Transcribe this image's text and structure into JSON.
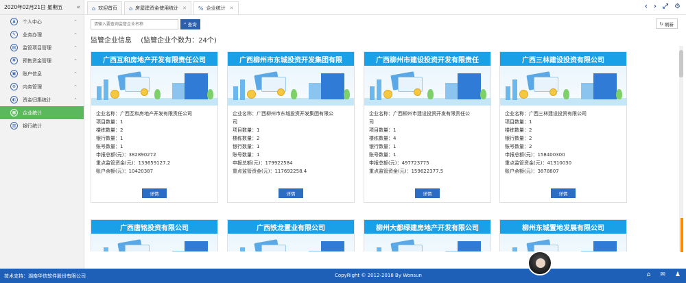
{
  "sidebar": {
    "date": "2020年02月21日 星期五",
    "collapse_icon": "«",
    "items": [
      {
        "label": "个人中心",
        "icon": "user-icon",
        "glyph": "♟"
      },
      {
        "label": "业务办理",
        "icon": "briefcase-icon",
        "glyph": "✎"
      },
      {
        "label": "监管项目管理",
        "icon": "project-icon",
        "glyph": "▤"
      },
      {
        "label": "预售资金管理",
        "icon": "fund-icon",
        "glyph": "¥"
      },
      {
        "label": "账户信息",
        "icon": "account-icon",
        "glyph": "▣"
      },
      {
        "label": "内务管理",
        "icon": "gear-icon",
        "glyph": "⚙"
      },
      {
        "label": "资金归集统计",
        "icon": "stats-icon",
        "glyph": "◐"
      },
      {
        "label": "企业统计",
        "icon": "enterprise-icon",
        "glyph": "▦",
        "active": true
      },
      {
        "label": "银行统计",
        "icon": "bank-icon",
        "glyph": "▥"
      }
    ]
  },
  "tabs": [
    {
      "label": "欢迎首页",
      "icon": "home-icon",
      "glyph": "⌂",
      "closable": false
    },
    {
      "label": "房屋建资金使用统计",
      "icon": "bank-icon",
      "glyph": "⌂",
      "closable": true
    },
    {
      "label": "企业统计",
      "icon": "percent-icon",
      "glyph": "%",
      "closable": true,
      "active": true
    }
  ],
  "window_controls": [
    "‹",
    "›",
    "⤢",
    "⚙"
  ],
  "toolbar": {
    "search_placeholder": "请输入要查询监管企业名称",
    "search_label": "查询",
    "refresh_label": "刷新"
  },
  "page": {
    "title": "监管企业信息",
    "count_text": "(监管企业个数为：24个)"
  },
  "labels": {
    "detail": "详情"
  },
  "cards": [
    {
      "header": "广西互和房地产开发有限责任公司",
      "lines": [
        "企业名称：广西互和房地产开发有限责任公司",
        "项目数量：1",
        "楼栋数量：2",
        "银行数量：1",
        "账号数量：1",
        "申报总额(元)：382890272",
        "重点监管资金(元)：133659127.2",
        "账户余额(元)：10420387"
      ]
    },
    {
      "header": "广西柳州市东城投资开发集团有限",
      "lines": [
        "企业名称：广西柳州市东城投资开发集团有限公",
        "司",
        "项目数量：1",
        "楼栋数量：2",
        "银行数量：1",
        "账号数量：1",
        "申报总额(元)：179922584",
        "重点监管资金(元)：117692258.4"
      ]
    },
    {
      "header": "广西柳州市建设投资开发有限责任",
      "lines": [
        "企业名称：广西柳州市建设投资开发有限责任公",
        "司",
        "项目数量：1",
        "楼栋数量：4",
        "银行数量：1",
        "账号数量：1",
        "申报总额(元)：497723775",
        "重点监管资金(元)：159622377.5"
      ]
    },
    {
      "header": "广西三林建设投资有限公司",
      "lines": [
        "企业名称：广西三林建设投资有限公司",
        "项目数量：1",
        "楼栋数量：2",
        "银行数量：2",
        "账号数量：2",
        "申报总额(元)：158400300",
        "重点监管资金(元)：41310030",
        "账户余额(元)：3878807"
      ]
    },
    {
      "header": "广西唐铭投资有限公司",
      "lines": []
    },
    {
      "header": "广西铁龙置业有限公司",
      "lines": []
    },
    {
      "header": "柳州大都绿建房地产开发有限公司",
      "lines": []
    },
    {
      "header": "柳州东城置地发展有限公司",
      "lines": []
    }
  ],
  "footer": {
    "tech": "技术支持：湖南华信软件股份有限公司",
    "copyright": "CopyRight © 2012-2018 By Wonsun"
  },
  "footer_icons": [
    "⌂",
    "✉",
    "♟"
  ]
}
